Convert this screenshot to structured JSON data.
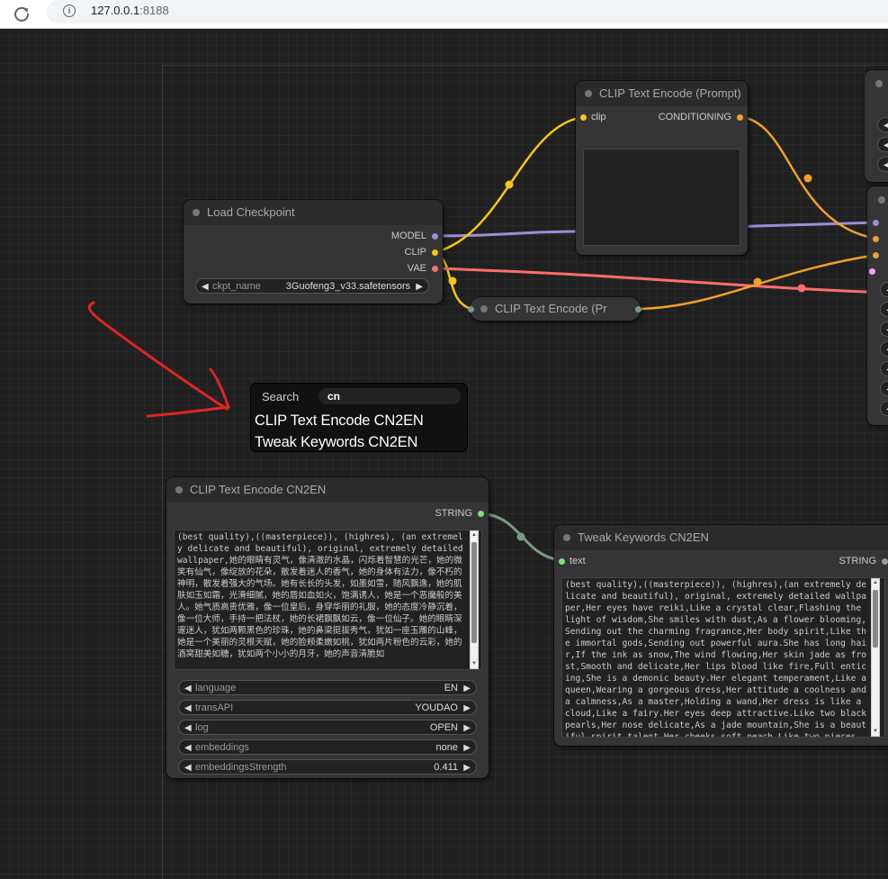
{
  "browser": {
    "url_host": "127.0.0.1",
    "url_port": ":8188"
  },
  "nodes": {
    "load_checkpoint": {
      "title": "Load Checkpoint",
      "outputs": [
        "MODEL",
        "CLIP",
        "VAE"
      ],
      "widget": {
        "label": "ckpt_name",
        "value": "3Guofeng3_v33.safetensors"
      }
    },
    "clip_text_encode_prompt": {
      "title": "CLIP Text Encode (Prompt)",
      "input": "clip",
      "output": "CONDITIONING"
    },
    "clip_text_encode_collapsed": {
      "title": "CLIP Text Encode (Pr"
    },
    "clip_text_encode_cn2en": {
      "title": "CLIP Text Encode CN2EN",
      "output": "STRING",
      "text": "(best quality),((masterpiece)), (highres), (an extremely delicate and beautiful), original, extremely detailed wallpaper,她的眼睛有灵气，像清澈的水晶，闪烁着智慧的光芒，她的微笑有仙气，像绽放的花朵，散发着迷人的香气，她的身体有法力，像不朽的神明，散发着强大的气场。她有长长的头发，如墨如雪，随风飘逸，她的肌肤如玉如霜，光滑细腻，她的唇如血如火，饱满诱人，她是一个恶魔般的美人。她气质高贵优雅，像一位皇后，身穿华丽的礼服，她的态度冷静沉着，像一位大师，手持一把法杖，她的长裙飘飘如云，像一位仙子。她的眼睛深邃迷人，犹如两颗黑色的珍珠，她的鼻梁挺拔秀气，犹如一座玉雕的山峰，她是一个美丽的灵根天赋，她的脸颊柔嫩如桃，犹如两片粉色的云彩，她的酒窝甜美如糖，犹如两个小小的月牙，她的声音清脆如",
      "widgets": [
        {
          "label": "language",
          "value": "EN"
        },
        {
          "label": "transAPI",
          "value": "YOUDAO"
        },
        {
          "label": "log",
          "value": "OPEN"
        },
        {
          "label": "embeddings",
          "value": "none"
        },
        {
          "label": "embeddingsStrength",
          "value": "0.411"
        }
      ]
    },
    "tweak_keywords_cn2en": {
      "title": "Tweak Keywords CN2EN",
      "input": "text",
      "output": "STRING",
      "text": "(best quality),((masterpiece)), (highres),(an extremely delicate and beautiful), original, extremely detailed wallpaper,Her eyes have reiki,Like a crystal clear,Flashing the light of wisdom,She smiles with dust,As a flower blooming,Sending out the charming fragrance,Her body spirit,Like the immortal gods,Sending out powerful aura.She has long hair,If the ink as snow,The wind flowing,Her skin jade as frost,Smooth and delicate,Her lips blood like fire,Full enticing,She is a demonic beauty.Her elegant temperament,Like a queen,Wearing a gorgeous dress,Her attitude a coolness and a calmness,As a master,Holding a wand,Her dress is like a cloud,Like a fairy.Her eyes deep attractive.Like two black pearls,Her nose delicate,As a jade mountain,She is a beautiful spirit talent,Her cheeks soft peach,Like two pieces"
    }
  },
  "search": {
    "label": "Search",
    "query": "cn",
    "results": [
      "CLIP Text Encode CN2EN",
      "Tweak Keywords CN2EN"
    ]
  },
  "colors": {
    "clip_link": "#f5c518",
    "model_link": "#9a8fd6",
    "vae_link": "#ff6e6e",
    "conditioning_link": "#f0a030",
    "string_link": "#7a9a84",
    "annotation_arrow": "#e02424"
  }
}
